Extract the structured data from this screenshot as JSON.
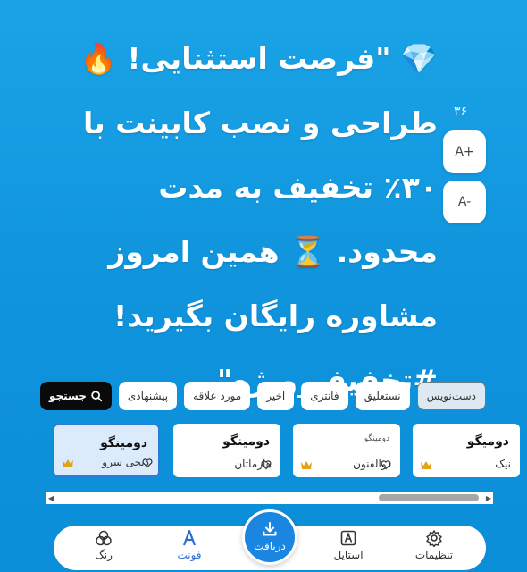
{
  "content": {
    "text": "💎 \"فرصت استثنایی! 🔥 طراحی و نصب کابینت با ۳۰٪ تخفیف به مدت محدود. ⏳ همین امروز مشاوره رایگان بگیرید! #تخفیف_ویژه\""
  },
  "size_controls": {
    "count": "۳۶",
    "increase_label": "A+",
    "decrease_label": "A-"
  },
  "filters": {
    "search_label": "جستجو",
    "chips": [
      "پیشنهادی",
      "مورد علاقه",
      "اخیر",
      "فانتزی",
      "نستعلیق",
      "دست‌نویس"
    ],
    "active_chip": "دست‌نویس"
  },
  "fonts": [
    {
      "sample": "دومیگو",
      "name": "نیک",
      "premium": true,
      "favorite": false,
      "selected": false
    },
    {
      "sample": "دومینگو",
      "name": "ذوالفنون",
      "premium": true,
      "favorite": false,
      "selected": false
    },
    {
      "sample": "دومینگو",
      "name": "هارماتان",
      "premium": false,
      "favorite": false,
      "selected": false
    },
    {
      "sample": "دومینگو",
      "name": "دیجی سرو",
      "premium": true,
      "favorite": false,
      "selected": true
    }
  ],
  "bottom_nav": {
    "settings": "تنظیمات",
    "style": "استایل",
    "download": "دریافت",
    "font": "فونت",
    "color": "رنگ"
  },
  "colors": {
    "background": "#1aa3e6",
    "accent": "#2b6fd6",
    "crown": "#e6a11a"
  }
}
